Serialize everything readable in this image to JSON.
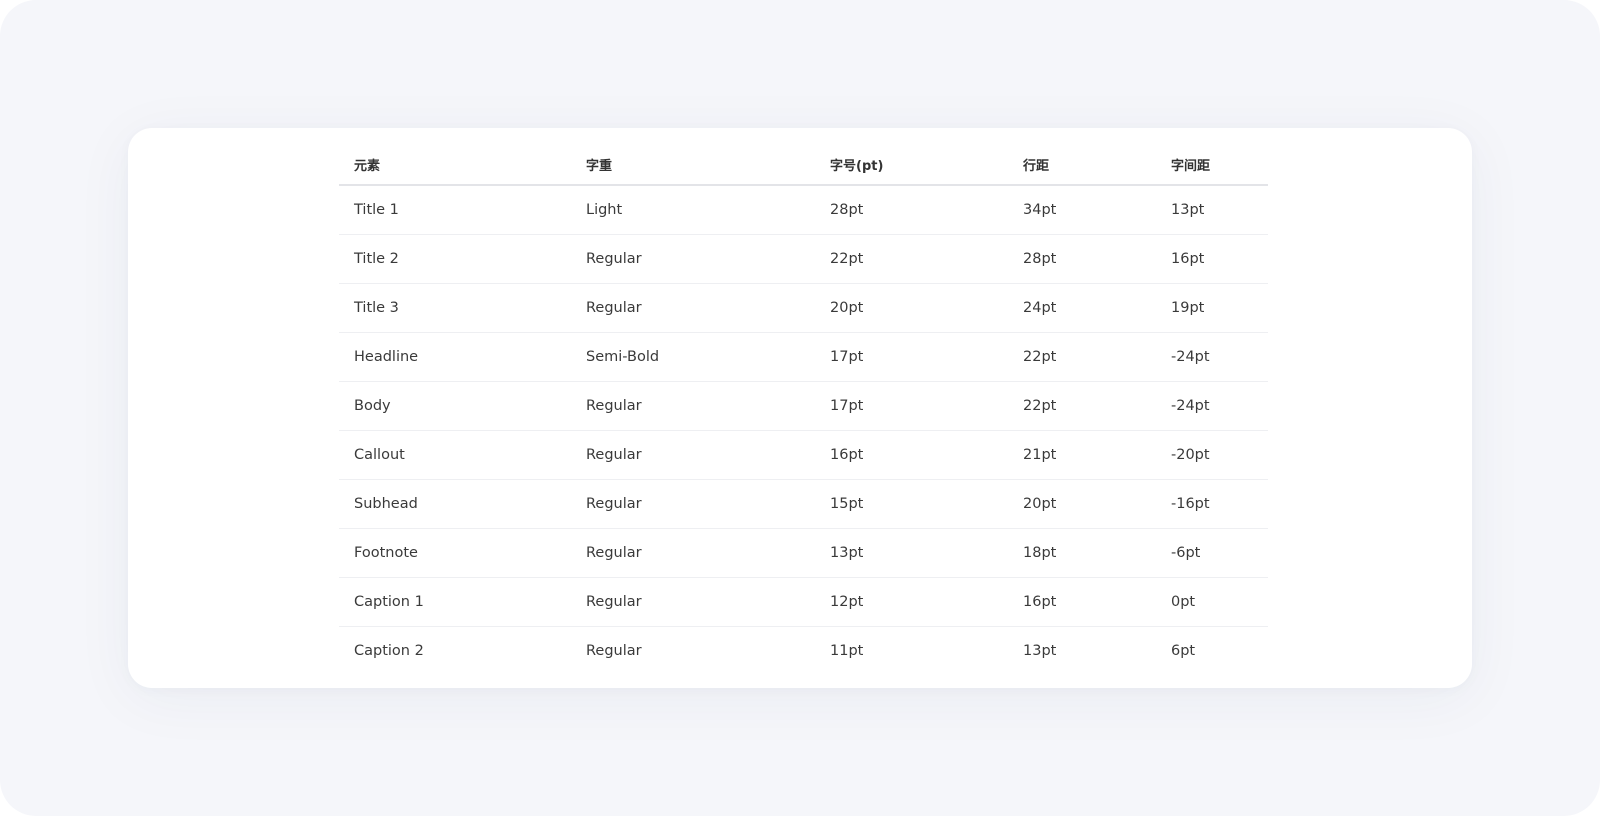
{
  "table": {
    "headers": [
      "元素",
      "字重",
      "字号(pt)",
      "行距",
      "字间距"
    ],
    "rows": [
      [
        "Title 1",
        "Light",
        "28pt",
        "34pt",
        "13pt"
      ],
      [
        "Title 2",
        "Regular",
        "22pt",
        "28pt",
        "16pt"
      ],
      [
        "Title 3",
        "Regular",
        "20pt",
        "24pt",
        "19pt"
      ],
      [
        "Headline",
        "Semi-Bold",
        "17pt",
        "22pt",
        "-24pt"
      ],
      [
        "Body",
        "Regular",
        "17pt",
        "22pt",
        "-24pt"
      ],
      [
        "Callout",
        "Regular",
        "16pt",
        "21pt",
        "-20pt"
      ],
      [
        "Subhead",
        "Regular",
        "15pt",
        "20pt",
        "-16pt"
      ],
      [
        "Footnote",
        "Regular",
        "13pt",
        "18pt",
        "-6pt"
      ],
      [
        "Caption 1",
        "Regular",
        "12pt",
        "16pt",
        "0pt"
      ],
      [
        "Caption 2",
        "Regular",
        "11pt",
        "13pt",
        "6pt"
      ]
    ]
  },
  "colors": {
    "page_background": "#f5f6fa",
    "card_background": "#ffffff",
    "header_text": "#333333",
    "body_text": "#3a3a3a",
    "divider": "#eeeff2"
  }
}
